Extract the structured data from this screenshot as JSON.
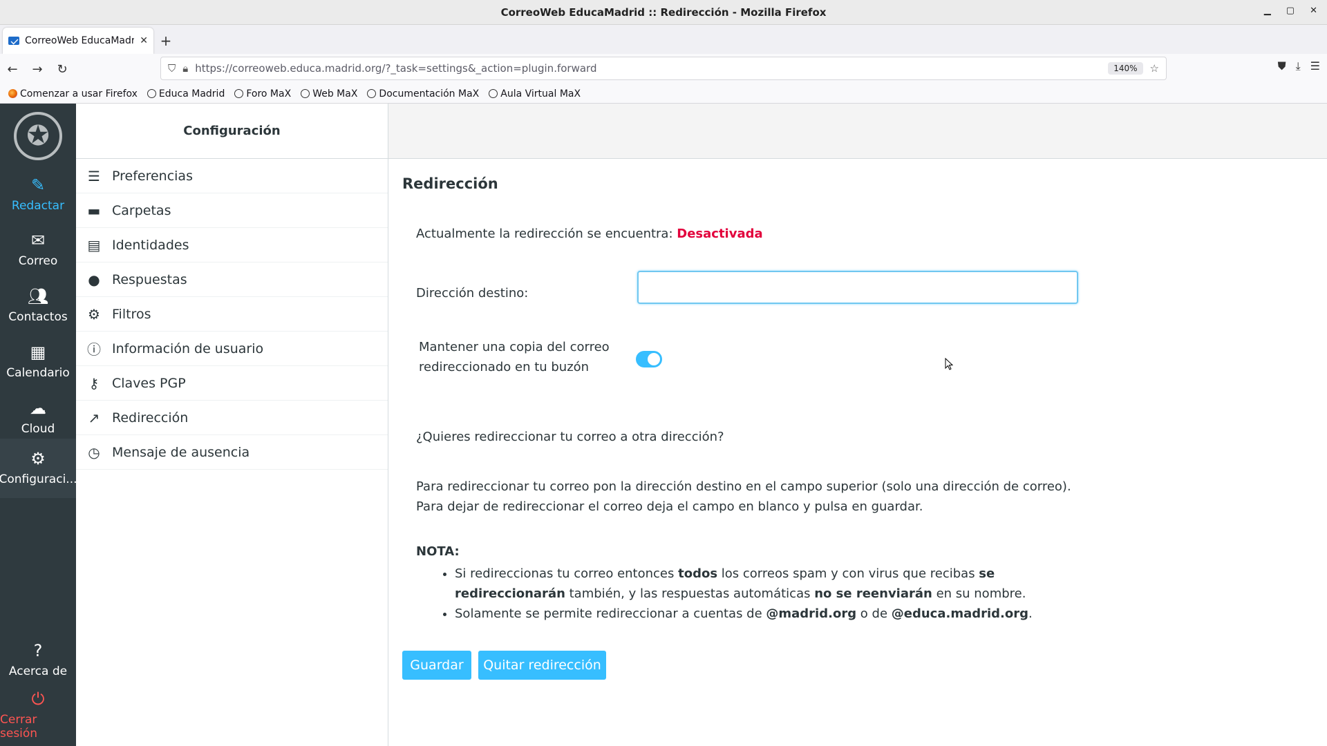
{
  "window": {
    "title": "CorreoWeb EducaMadrid :: Redirección - Mozilla Firefox"
  },
  "browser": {
    "tab_label": "CorreoWeb EducaMadrid",
    "url": "https://correoweb.educa.madrid.org/?_task=settings&_action=plugin.forward",
    "zoom": "140%",
    "bookmarks": [
      "Comenzar a usar Firefox",
      "Educa Madrid",
      "Foro MaX",
      "Web MaX",
      "Documentación MaX",
      "Aula Virtual MaX"
    ]
  },
  "leftnav": {
    "compose": "Redactar",
    "mail": "Correo",
    "contacts": "Contactos",
    "calendar": "Calendario",
    "cloud": "Cloud",
    "settings": "Configuraci...",
    "about": "Acerca de",
    "logout": "Cerrar sesión"
  },
  "settings": {
    "header": "Configuración",
    "items": [
      "Preferencias",
      "Carpetas",
      "Identidades",
      "Respuestas",
      "Filtros",
      "Información de usuario",
      "Claves PGP",
      "Redirección",
      "Mensaje de ausencia"
    ]
  },
  "main": {
    "title": "Redirección",
    "status_label": "Actualmente la redirección se encuentra:",
    "status_value": "Desactivada",
    "dest_label": "Dirección destino:",
    "dest_value": "",
    "copy_label": "Mantener una copia del correo redireccionado en tu buzón",
    "copy_enabled": true,
    "question": "¿Quieres redireccionar tu correo a otra dirección?",
    "para1": "Para redireccionar tu correo pon la dirección destino en el campo superior (solo una dirección de correo).",
    "para2": "Para dejar de redireccionar el correo deja el campo en blanco y pulsa en guardar.",
    "nota": "NOTA:",
    "b1_part1": "Si redireccionas tu correo entonces ",
    "b1_bold1": "todos",
    "b1_part2": " los correos spam y con virus que recibas ",
    "b1_bold2": "se redireccionarán",
    "b1_part3": " también, y las respuestas automáticas ",
    "b1_bold3": "no se reenviarán",
    "b1_part4": " en su nombre.",
    "b2_part1": "Solamente se permite redireccionar a cuentas de ",
    "b2_bold1": "@madrid.org",
    "b2_part2": " o de ",
    "b2_bold2": "@educa.madrid.org",
    "b2_part3": ".",
    "save_button": "Guardar",
    "remove_button": "Quitar redirección"
  },
  "colors": {
    "accent": "#37beff",
    "danger": "#e2003c",
    "sidebar": "#2f3a3f"
  }
}
